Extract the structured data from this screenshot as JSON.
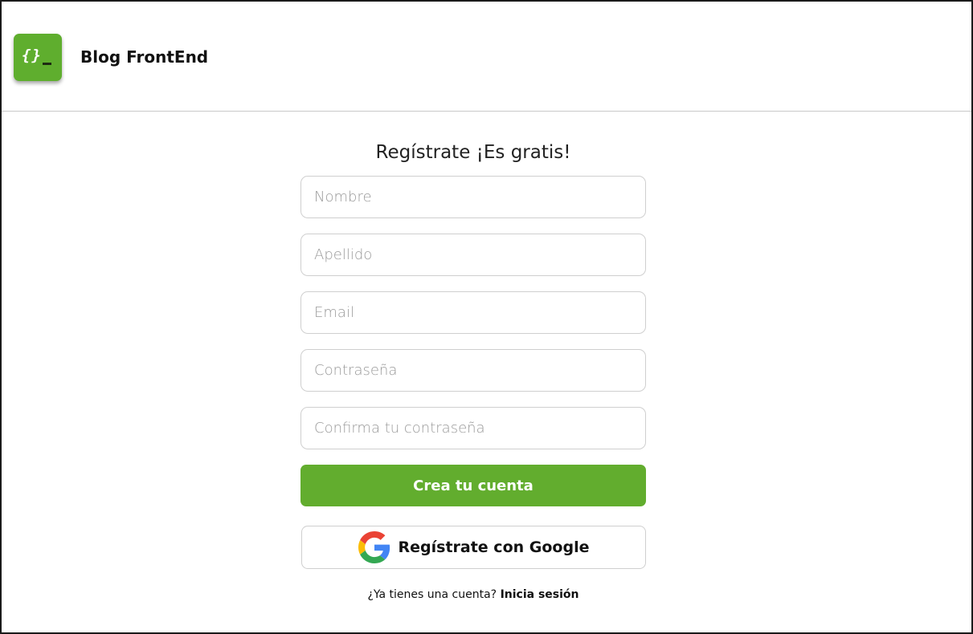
{
  "header": {
    "logo_text": "{}",
    "brand": "Blog FrontEnd"
  },
  "form": {
    "title": "Regístrate ¡Es gratis!",
    "fields": [
      {
        "placeholder": "Nombre",
        "value": ""
      },
      {
        "placeholder": "Apellido",
        "value": ""
      },
      {
        "placeholder": "Email",
        "value": ""
      },
      {
        "placeholder": "Contraseña",
        "value": ""
      },
      {
        "placeholder": "Confirma tu contraseña",
        "value": ""
      }
    ],
    "submit_label": "Crea tu cuenta",
    "google_label": "Regístrate con Google",
    "google_icon": "google-icon",
    "login_prompt": "¿Ya tienes una cuenta?",
    "login_link": "Inicia sesión"
  },
  "colors": {
    "brand_green": "#62ad2e",
    "border": "#cfcfcf",
    "text": "#111111"
  }
}
